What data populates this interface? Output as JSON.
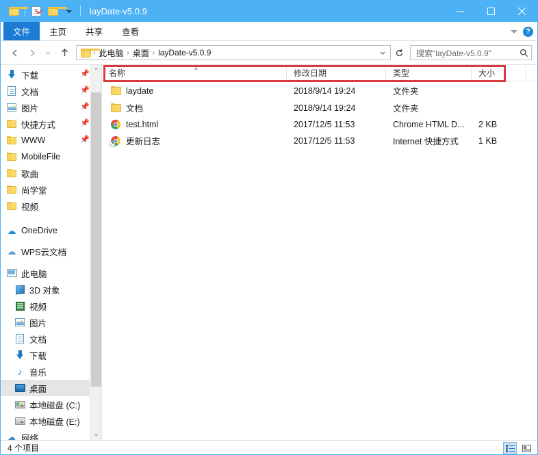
{
  "window": {
    "title": "layDate-v5.0.9",
    "titlebar_color": "#4db2f5",
    "quick_access": [
      {
        "name": "folder-icon",
        "label": ""
      },
      {
        "name": "properties-icon",
        "label": ""
      },
      {
        "name": "new-folder-icon",
        "label": ""
      }
    ],
    "controls": {
      "minimize": "minimize",
      "maximize": "maximize",
      "close": "close"
    }
  },
  "ribbon": {
    "tabs": [
      {
        "label": "文件",
        "active": true
      },
      {
        "label": "主页",
        "active": false
      },
      {
        "label": "共享",
        "active": false
      },
      {
        "label": "查看",
        "active": false
      }
    ],
    "expand_label": "",
    "help_label": "?"
  },
  "address": {
    "back_label": "←",
    "forward_label": "→",
    "recent_label": "",
    "up_label": "↑",
    "crumbs": [
      "此电脑",
      "桌面",
      "layDate-v5.0.9"
    ],
    "separator": "›",
    "refresh_label": "↻",
    "dropdown_label": "⌄"
  },
  "search": {
    "placeholder": "搜索\"layDate-v5.0.9\"",
    "icon": "search-icon"
  },
  "sidebar": {
    "items": [
      {
        "label": "下载",
        "icon": "download-icon",
        "pinned": true,
        "indent": false,
        "selected": false
      },
      {
        "label": "文档",
        "icon": "document-icon",
        "pinned": true,
        "indent": false,
        "selected": false
      },
      {
        "label": "图片",
        "icon": "pictures-icon",
        "pinned": true,
        "indent": false,
        "selected": false
      },
      {
        "label": "快捷方式",
        "icon": "folder-icon",
        "pinned": true,
        "indent": false,
        "selected": false
      },
      {
        "label": "WWW",
        "icon": "folder-icon",
        "pinned": true,
        "indent": false,
        "selected": false
      },
      {
        "label": "MobileFile",
        "icon": "folder-icon",
        "pinned": false,
        "indent": false,
        "selected": false
      },
      {
        "label": "歌曲",
        "icon": "folder-icon",
        "pinned": false,
        "indent": false,
        "selected": false
      },
      {
        "label": "尚学堂",
        "icon": "folder-icon",
        "pinned": false,
        "indent": false,
        "selected": false
      },
      {
        "label": "视频",
        "icon": "folder-icon",
        "pinned": false,
        "indent": false,
        "selected": false
      },
      {
        "label": "OneDrive",
        "icon": "onedrive-icon",
        "pinned": false,
        "indent": false,
        "selected": false
      },
      {
        "label": "WPS云文档",
        "icon": "wps-cloud-icon",
        "pinned": false,
        "indent": false,
        "selected": false
      },
      {
        "label": "此电脑",
        "icon": "this-pc-icon",
        "pinned": false,
        "indent": false,
        "selected": false
      },
      {
        "label": "3D 对象",
        "icon": "3d-objects-icon",
        "pinned": false,
        "indent": true,
        "selected": false
      },
      {
        "label": "视频",
        "icon": "videos-icon",
        "pinned": false,
        "indent": true,
        "selected": false
      },
      {
        "label": "图片",
        "icon": "pictures-icon",
        "pinned": false,
        "indent": true,
        "selected": false
      },
      {
        "label": "文档",
        "icon": "document-icon",
        "pinned": false,
        "indent": true,
        "selected": false
      },
      {
        "label": "下载",
        "icon": "download-icon",
        "pinned": false,
        "indent": true,
        "selected": false
      },
      {
        "label": "音乐",
        "icon": "music-icon",
        "pinned": false,
        "indent": true,
        "selected": false
      },
      {
        "label": "桌面",
        "icon": "desktop-icon",
        "pinned": false,
        "indent": true,
        "selected": true
      },
      {
        "label": "本地磁盘 (C:)",
        "icon": "system-drive-icon",
        "pinned": false,
        "indent": true,
        "selected": false
      },
      {
        "label": "本地磁盘 (E:)",
        "icon": "drive-icon",
        "pinned": false,
        "indent": true,
        "selected": false
      },
      {
        "label": "网络",
        "icon": "network-icon",
        "pinned": false,
        "indent": false,
        "selected": false
      }
    ],
    "scroll_up": "⌃",
    "scroll_down": "⌄"
  },
  "filelist": {
    "columns": [
      "名称",
      "修改日期",
      "类型",
      "大小"
    ],
    "sort_indicator": "▲",
    "rows": [
      {
        "name": "laydate",
        "date": "2018/9/14 19:24",
        "type": "文件夹",
        "size": "",
        "icon": "folder-icon",
        "highlighted": true
      },
      {
        "name": "文档",
        "date": "2018/9/14 19:24",
        "type": "文件夹",
        "size": "",
        "icon": "folder-icon",
        "highlighted": false
      },
      {
        "name": "test.html",
        "date": "2017/12/5 11:53",
        "type": "Chrome HTML D...",
        "size": "2 KB",
        "icon": "chrome-icon",
        "highlighted": false
      },
      {
        "name": "更新日志",
        "date": "2017/12/5 11:53",
        "type": "Internet 快捷方式",
        "size": "1 KB",
        "icon": "chrome-shortcut-icon",
        "highlighted": false
      }
    ],
    "annotation_color": "#d93a3f"
  },
  "statusbar": {
    "item_count": "4 个项目",
    "view_details": "details-view",
    "view_tiles": "large-icons-view"
  }
}
